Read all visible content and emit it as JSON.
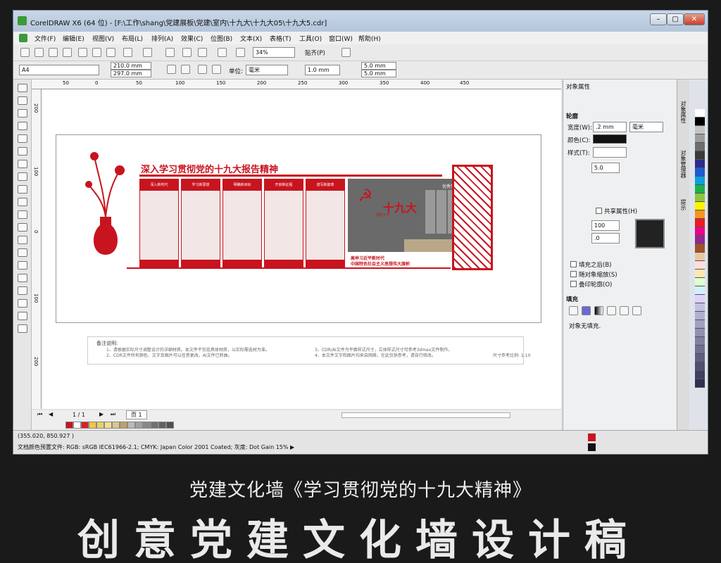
{
  "window": {
    "title": "CorelDRAW X6 (64 位) - [F:\\工作\\shang\\党建展板\\党建\\室内\\十九大\\十九大05\\十九大5.cdr]",
    "min": "–",
    "max": "▢",
    "close": "✕"
  },
  "menu": [
    "文件(F)",
    "编辑(E)",
    "视图(V)",
    "布局(L)",
    "排列(A)",
    "效果(C)",
    "位图(B)",
    "文本(X)",
    "表格(T)",
    "工具(O)",
    "窗口(W)",
    "帮助(H)"
  ],
  "toolbar": {
    "zoom": "34%",
    "snap": "贴齐(P)"
  },
  "propbar": {
    "paper": "A4",
    "width": "210.0 mm",
    "height": "297.0 mm",
    "unit_label": "单位:",
    "unit": "毫米",
    "nudge": "1.0 mm",
    "dup_x": "5.0 mm",
    "dup_y": "5.0 mm"
  },
  "ruler_h": [
    "50",
    "0",
    "50",
    "100",
    "150",
    "200",
    "250",
    "300",
    "350",
    "400",
    "450"
  ],
  "ruler_v": [
    "200",
    "150",
    "100",
    "50",
    "0",
    "50",
    "100",
    "150",
    "200",
    "250",
    "300",
    "350",
    "400",
    "450",
    "500",
    "550"
  ],
  "design": {
    "heading": "深入学习贯彻党的十九大报告精神",
    "panels": [
      "深入新时代",
      "学习新思想",
      "明确新目标",
      "开启新征程",
      "谱写新篇章"
    ],
    "center_title": "十九大",
    "center_small": "党的十九",
    "honor": "优秀党员",
    "slogan1": "高举习近平新时代",
    "slogan2": "中国特色社会主义思想伟大旗帜"
  },
  "notes": {
    "title": "备注说明:",
    "lines": [
      "1、请根据实际尺寸调整设计的详细材质。本文件不包括具体材质，以实际需选材为准。",
      "2、CDR文件所有颜色、文字及图片可以任意更改。AI文件已转曲。",
      "3、CDR/AI文件为平面样式尺寸，立体样式尺寸可参考3dmax文件制作。",
      "4、本文件文字和图片均来自网络，在此仅供参考，请自行修改。"
    ],
    "scale": "尺寸参考比例: 1:10"
  },
  "pagebar": {
    "counter": "1 / 1",
    "page_tab": "页 1"
  },
  "status": {
    "coords": "(355.020, 850.927 )",
    "color_profile": "文档颜色预置文件: RGB: sRGB IEC61966-2.1; CMYK: Japan Color 2001 Coated; 灰度: Dot Gain 15% ▶"
  },
  "docker": {
    "title": "对象属性",
    "outline": "轮廓",
    "width_label": "宽度(W):",
    "width_val": ".2 mm",
    "width_unit": "毫米",
    "color_label": "颜色(C):",
    "style_label": "样式(T):",
    "miter": "5.0",
    "share": "共享属性(H)",
    "stretch": "100",
    "angle": ".0",
    "fill_behind": "填充之后(B)",
    "scale_obj": "随对象缩放(S)",
    "overprint": "叠印轮廓(O)",
    "fill": "填充",
    "no_fill": "对象无填充."
  },
  "tabs_vertical": [
    "对象属性",
    "对象管理器",
    "提示"
  ],
  "palette": [
    "#ffffff",
    "#000000",
    "#c4c4c4",
    "#9c9c9c",
    "#6e6e6e",
    "#3a3a3a",
    "#2b2b8c",
    "#1b5bd4",
    "#0aa0e0",
    "#19b24b",
    "#8dc63f",
    "#fff200",
    "#f7941d",
    "#ed1c24",
    "#ec008c",
    "#92278f",
    "#a0522d",
    "#e8c8a0",
    "#ffdede",
    "#ffe8b0",
    "#e0ffd0",
    "#d0f0ff",
    "#e0d0ff",
    "#c0c0e0",
    "#b0b0d0",
    "#a0a0c0",
    "#9090b0",
    "#8080a0",
    "#707090",
    "#606080",
    "#505070",
    "#404060",
    "#303050"
  ],
  "bottom_palette": [
    "#c8141e",
    "#ffffff",
    "#d81e28",
    "#f2c44a",
    "#e8d06a",
    "#f0e090",
    "#d8c890",
    "#c0a060",
    "#b8b8b8",
    "#a0a0a0",
    "#888888",
    "#707070",
    "#606060",
    "#505050"
  ],
  "caption": "党建文化墙《学习贯彻党的十九大精神》",
  "bigtitle": "创意党建文化墙设计稿",
  "colors": {
    "party_red": "#c8141e",
    "dark_panel": "#6a6a6a"
  }
}
